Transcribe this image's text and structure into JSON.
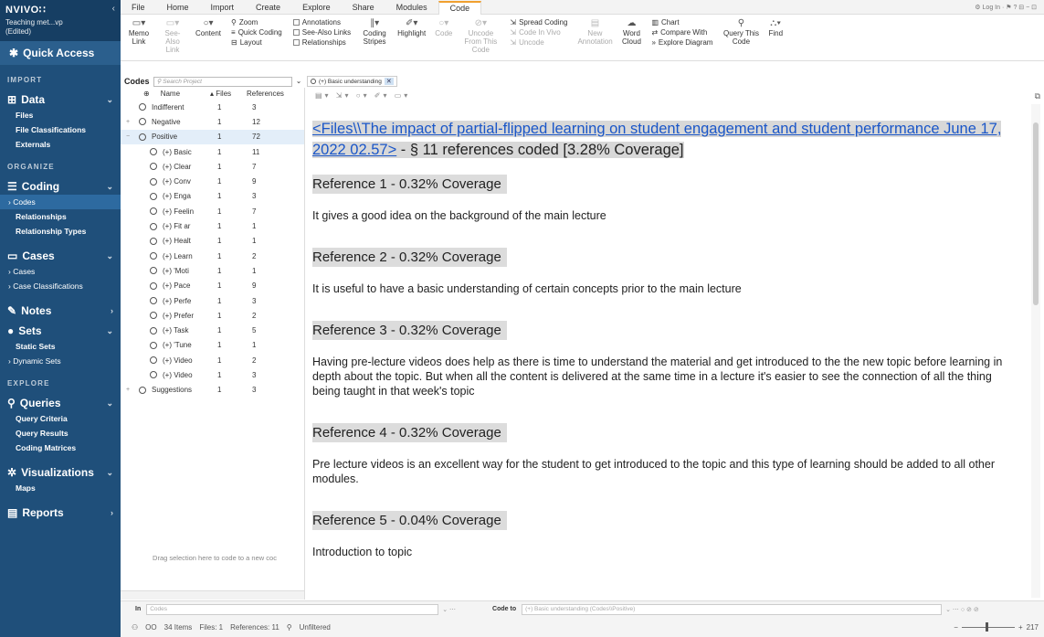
{
  "app": {
    "logo": "NVIVO∷",
    "project_line1": "Teaching met...vp",
    "project_line2": "(Edited)",
    "quick_access": "Quick Access"
  },
  "nav": {
    "import_label": "IMPORT",
    "data": "Data",
    "files": "Files",
    "file_classifications": "File Classifications",
    "externals": "Externals",
    "organize_label": "ORGANIZE",
    "coding": "Coding",
    "codes": "Codes",
    "relationships": "Relationships",
    "relationship_types": "Relationship Types",
    "cases": "Cases",
    "cases_sub": "Cases",
    "case_classifications": "Case Classifications",
    "notes": "Notes",
    "sets": "Sets",
    "static_sets": "Static Sets",
    "dynamic_sets": "Dynamic Sets",
    "explore_label": "EXPLORE",
    "queries": "Queries",
    "query_criteria": "Query Criteria",
    "query_results": "Query Results",
    "coding_matrices": "Coding Matrices",
    "visualizations": "Visualizations",
    "maps": "Maps",
    "reports": "Reports"
  },
  "ribbon_tabs": [
    "File",
    "Home",
    "Import",
    "Create",
    "Explore",
    "Share",
    "Modules",
    "Code"
  ],
  "active_tab": "Code",
  "tab_right": "Log In",
  "ribbon": {
    "memo_link": "Memo Link",
    "see_also_link": "See-Also Link",
    "content": "Content",
    "zoom": "Zoom",
    "quick_coding": "Quick Coding",
    "layout": "Layout",
    "annotations": "Annotations",
    "see_also_links": "See-Also Links",
    "relationships": "Relationships",
    "coding_stripes": "Coding Stripes",
    "highlight": "Highlight",
    "code": "Code",
    "uncode_from_this_code": "Uncode From This Code",
    "spread_coding": "Spread Coding",
    "code_in_vivo": "Code In Vivo",
    "uncode": "Uncode",
    "new_annotation": "New Annotation",
    "word_cloud": "Word Cloud",
    "chart": "Chart",
    "compare_with": "Compare With",
    "explore_diagram": "Explore Diagram",
    "query_this_code": "Query This Code",
    "find": "Find"
  },
  "codes_panel": {
    "title": "Codes",
    "search_placeholder": "Search Project",
    "col_name": "Name",
    "col_files": "Files",
    "col_references": "References",
    "rows": [
      {
        "name": "Indifferent",
        "files": "1",
        "refs": "3",
        "level": 0,
        "expand": ""
      },
      {
        "name": "Negative",
        "files": "1",
        "refs": "12",
        "level": 0,
        "expand": "+"
      },
      {
        "name": "Positive",
        "files": "1",
        "refs": "72",
        "level": 0,
        "expand": "−"
      },
      {
        "name": "(+) Basic",
        "files": "1",
        "refs": "11",
        "level": 1,
        "expand": ""
      },
      {
        "name": "(+) Clear",
        "files": "1",
        "refs": "7",
        "level": 1,
        "expand": ""
      },
      {
        "name": "(+) Conv",
        "files": "1",
        "refs": "9",
        "level": 1,
        "expand": ""
      },
      {
        "name": "(+) Enga",
        "files": "1",
        "refs": "3",
        "level": 1,
        "expand": ""
      },
      {
        "name": "(+) Feelin",
        "files": "1",
        "refs": "7",
        "level": 1,
        "expand": ""
      },
      {
        "name": "(+) Fit ar",
        "files": "1",
        "refs": "1",
        "level": 1,
        "expand": ""
      },
      {
        "name": "(+) Healt",
        "files": "1",
        "refs": "1",
        "level": 1,
        "expand": ""
      },
      {
        "name": "(+) Learn",
        "files": "1",
        "refs": "2",
        "level": 1,
        "expand": ""
      },
      {
        "name": "(+) 'Moti",
        "files": "1",
        "refs": "1",
        "level": 1,
        "expand": ""
      },
      {
        "name": "(+) Pace",
        "files": "1",
        "refs": "9",
        "level": 1,
        "expand": ""
      },
      {
        "name": "(+) Perfe",
        "files": "1",
        "refs": "3",
        "level": 1,
        "expand": ""
      },
      {
        "name": "(+) Prefer",
        "files": "1",
        "refs": "2",
        "level": 1,
        "expand": ""
      },
      {
        "name": "(+) Task",
        "files": "1",
        "refs": "5",
        "level": 1,
        "expand": ""
      },
      {
        "name": "(+) 'Tune",
        "files": "1",
        "refs": "1",
        "level": 1,
        "expand": ""
      },
      {
        "name": "(+) Video",
        "files": "1",
        "refs": "2",
        "level": 1,
        "expand": ""
      },
      {
        "name": "(+) Video",
        "files": "1",
        "refs": "3",
        "level": 1,
        "expand": ""
      },
      {
        "name": "Suggestions",
        "files": "1",
        "refs": "3",
        "level": 0,
        "expand": "+"
      }
    ],
    "drag_hint": "Drag selection here to code to a new coc"
  },
  "detail": {
    "tab_label": "(+) Basic understanding",
    "source_link": "<Files\\\\The impact of partial-flipped learning on student engagement and student performance June 17, 2022 02.57>",
    "source_suffix": " - § 11 references coded  [3.28% Coverage]",
    "references": [
      {
        "heading": "Reference 1 - 0.32% Coverage",
        "text": "It gives a good idea on the background of the main lecture"
      },
      {
        "heading": "Reference 2 - 0.32% Coverage",
        "text": "It is useful to have a basic understanding of certain concepts prior to the main lecture"
      },
      {
        "heading": "Reference 3 - 0.32% Coverage",
        "text": "Having pre-lecture videos does help as there is time to understand the material and get introduced to the the new topic before learning in depth about the topic. But when all the content is delivered at the same time in a lecture it's easier to see the connection of all the thing being taught in that week's topic"
      },
      {
        "heading": "Reference 4 - 0.32% Coverage",
        "text": "Pre lecture videos is an excellent way for the student to get introduced to the topic and this type of learning should be added to all other modules."
      },
      {
        "heading": "Reference 5 - 0.04% Coverage",
        "text": "Introduction to topic"
      }
    ]
  },
  "codebar": {
    "in_label": "In",
    "in_value": "Codes",
    "code_to_label": "Code to",
    "code_to_value": "(+) Basic understanding (Codes\\\\Positive)"
  },
  "status": {
    "user": "OO",
    "items": "34 Items",
    "files": "Files: 1",
    "references": "References: 11",
    "filter": "Unfiltered",
    "zoom": "217"
  }
}
